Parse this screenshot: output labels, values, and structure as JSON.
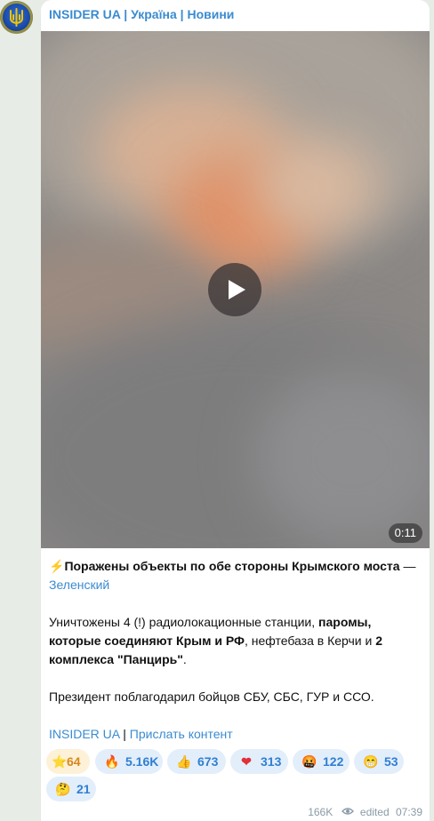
{
  "channel": {
    "name": "INSIDER UA | Україна | Новини"
  },
  "video": {
    "duration": "0:11"
  },
  "post": {
    "bolt": "⚡",
    "headline": "Поражены объекты по обе стороны Крымского моста",
    "dash": " — ",
    "source_link": "Зеленский",
    "p2_a": "Уничтожены 4 (!) радиолокационные станции, ",
    "p2_b": "паромы, которые соединяют Крым и РФ",
    "p2_c": ", нефтебаза в Керчи и ",
    "p2_d": "2 комплекса \"Панцирь\"",
    "p2_e": ".",
    "p3": "Президент поблагодарил бойцов СБУ, СБС, ГУР и ССО.",
    "footer_link1": "INSIDER UA",
    "footer_sep": " | ",
    "footer_link2": "Прислать контент"
  },
  "reactions": [
    {
      "emoji": "⭐",
      "icon": "star-icon",
      "count": "64"
    },
    {
      "emoji": "🔥",
      "icon": "fire-icon",
      "count": "5.16K"
    },
    {
      "emoji": "👍",
      "icon": "thumbs-up-icon",
      "count": "673"
    },
    {
      "emoji": "❤",
      "icon": "heart-icon",
      "count": "313"
    },
    {
      "emoji": "🤬",
      "icon": "angry-face-icon",
      "count": "122"
    },
    {
      "emoji": "😁",
      "icon": "grin-face-icon",
      "count": "53"
    },
    {
      "emoji": "🤔",
      "icon": "thinking-face-icon",
      "count": "21"
    }
  ],
  "meta": {
    "views": "166K",
    "edited": "edited",
    "time": "07:39"
  },
  "colors": {
    "link": "#3a8bd0",
    "reaction_bg": "#e3eefb",
    "star_bg": "#fdf1d8"
  }
}
